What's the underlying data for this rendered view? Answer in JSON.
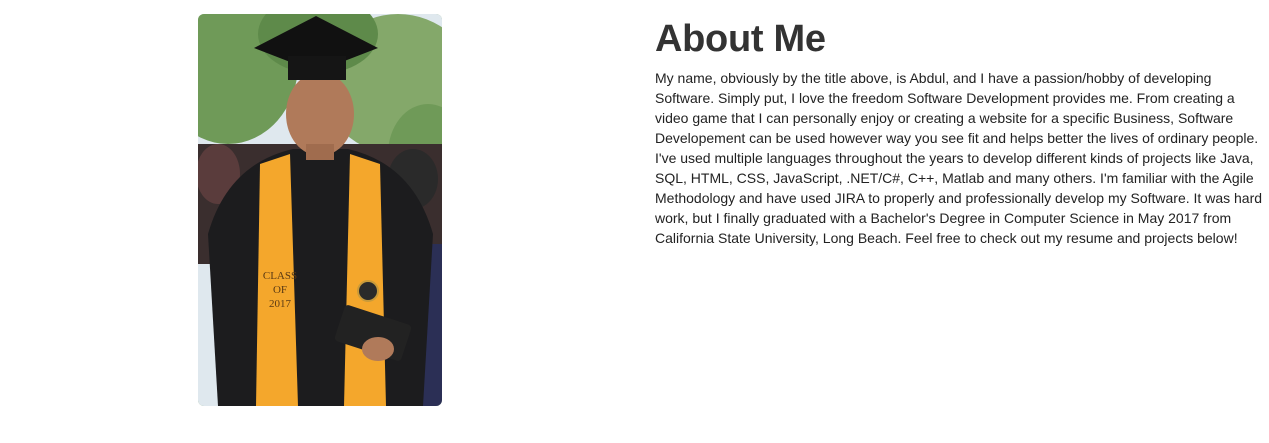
{
  "profile_photo": {
    "alt": "Graduation photo",
    "stole_text": [
      "CLASS",
      "OF",
      "2017"
    ],
    "colors": {
      "gown": "#1c1c1e",
      "stole": "#f4a72c",
      "foliage": "#6f9a58",
      "sky": "#dfe8ee"
    }
  },
  "about": {
    "title": "About Me",
    "bio": "My name, obviously by the title above, is Abdul, and I have a passion/hobby of developing Software. Simply put, I love the freedom Software Development provides me. From creating a video game that I can personally enjoy or creating a website for a specific Business, Software Developement can be used however way you see fit and helps better the lives of ordinary people. I've used multiple languages throughout the years to develop different kinds of projects like Java, SQL, HTML, CSS, JavaScript, .NET/C#, C++, Matlab and many others. I'm familiar with the Agile Methodology and have used JIRA to properly and professionally develop my Software. It was hard work, but I finally graduated with a Bachelor's Degree in Computer Science in May 2017 from California State University, Long Beach. Feel free to check out my resume and projects below!"
  }
}
